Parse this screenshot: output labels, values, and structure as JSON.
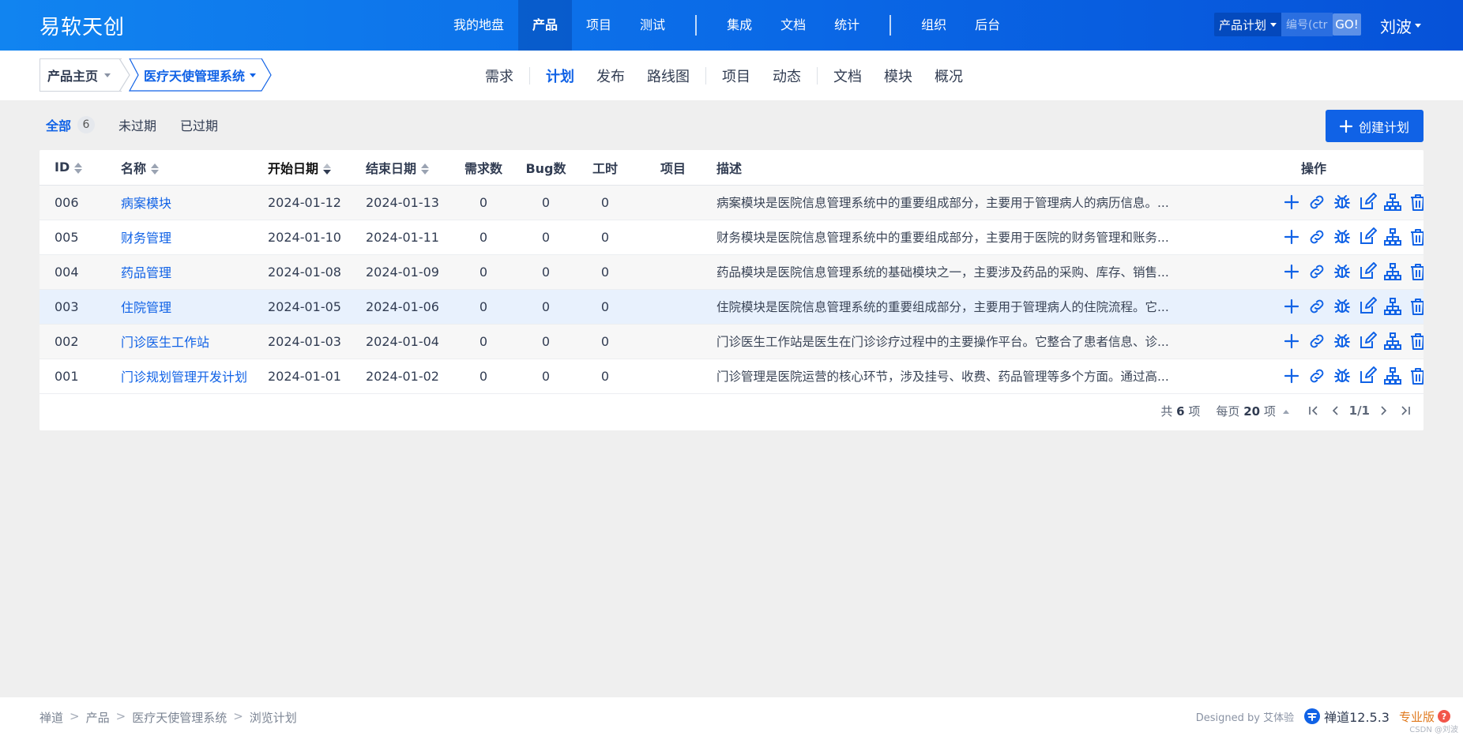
{
  "app": {
    "brand": "易软天创",
    "nav": [
      "我的地盘",
      "产品",
      "项目",
      "测试",
      "集成",
      "文档",
      "统计",
      "组织",
      "后台"
    ],
    "active_nav": "产品",
    "search": {
      "type": "产品计划",
      "placeholder": "编号(ctr",
      "go": "GO!"
    },
    "user": "刘波"
  },
  "subheader": {
    "home": "产品主页",
    "product": "医疗天使管理系统",
    "tabs": [
      "需求",
      "计划",
      "发布",
      "路线图",
      "项目",
      "动态",
      "文档",
      "模块",
      "概况"
    ],
    "active_tab": "计划"
  },
  "filters": {
    "all": "全部",
    "all_count": "6",
    "unexpired": "未过期",
    "expired": "已过期"
  },
  "create_button": "创建计划",
  "table": {
    "headers": {
      "id": "ID",
      "name": "名称",
      "begin": "开始日期",
      "end": "结束日期",
      "stories": "需求数",
      "bugs": "Bug数",
      "hours": "工时",
      "project": "项目",
      "desc": "描述",
      "actions": "操作"
    },
    "rows": [
      {
        "id": "006",
        "name": "病案模块",
        "begin": "2024-01-12",
        "end": "2024-01-13",
        "stories": "0",
        "bugs": "0",
        "hours": "0",
        "project": "",
        "desc": "病案模块是医院信息管理系统中的重要组成部分，主要用于管理病人的病历信息。..."
      },
      {
        "id": "005",
        "name": "财务管理",
        "begin": "2024-01-10",
        "end": "2024-01-11",
        "stories": "0",
        "bugs": "0",
        "hours": "0",
        "project": "",
        "desc": "财务模块是医院信息管理系统中的重要组成部分，主要用于医院的财务管理和账务..."
      },
      {
        "id": "004",
        "name": "药品管理",
        "begin": "2024-01-08",
        "end": "2024-01-09",
        "stories": "0",
        "bugs": "0",
        "hours": "0",
        "project": "",
        "desc": "药品模块是医院信息管理系统的基础模块之一，主要涉及药品的采购、库存、销售..."
      },
      {
        "id": "003",
        "name": "住院管理",
        "begin": "2024-01-05",
        "end": "2024-01-06",
        "stories": "0",
        "bugs": "0",
        "hours": "0",
        "project": "",
        "desc": "住院模块是医院信息管理系统的重要组成部分，主要用于管理病人的住院流程。它..."
      },
      {
        "id": "002",
        "name": "门诊医生工作站",
        "begin": "2024-01-03",
        "end": "2024-01-04",
        "stories": "0",
        "bugs": "0",
        "hours": "0",
        "project": "",
        "desc": "门诊医生工作站是医生在门诊诊疗过程中的主要操作平台。它整合了患者信息、诊..."
      },
      {
        "id": "001",
        "name": "门诊规划管理开发计划",
        "begin": "2024-01-01",
        "end": "2024-01-02",
        "stories": "0",
        "bugs": "0",
        "hours": "0",
        "project": "",
        "desc": "门诊管理是医院运营的核心环节，涉及挂号、收费、药品管理等多个方面。通过高..."
      }
    ],
    "action_icons": [
      "plus-icon",
      "link-icon",
      "bug-icon",
      "edit-icon",
      "sitemap-icon",
      "trash-icon"
    ]
  },
  "pager": {
    "total_prefix": "共",
    "total": "6",
    "total_suffix": "项",
    "per_prefix": "每页",
    "per": "20",
    "per_suffix": "项",
    "page": "1/1"
  },
  "footer": {
    "crumbs": [
      "禅道",
      "产品",
      "医疗天使管理系统",
      "浏览计划"
    ],
    "designed_by": "Designed by 艾体验",
    "version": "禅道12.5.3",
    "edition": "专业版",
    "watermark": "CSDN @刘波"
  },
  "colors": {
    "primary": "#1062e6",
    "topbar": "#0a68e6",
    "row_highlight": "#e8f1fd"
  }
}
